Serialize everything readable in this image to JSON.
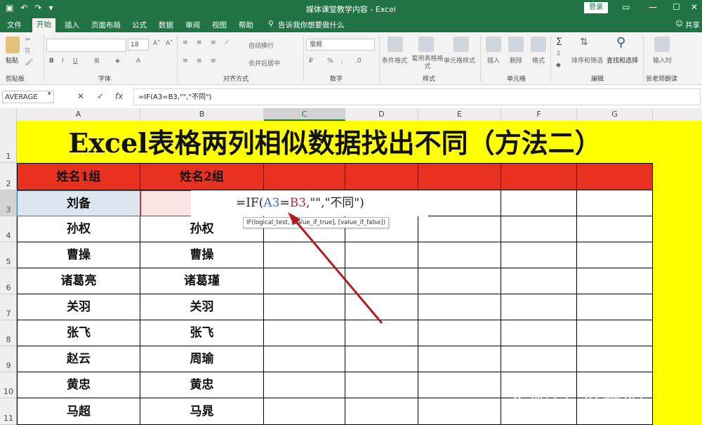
{
  "window": {
    "title": "媒体课堂教学内容 - Excel",
    "login_label": "登录",
    "share_label": "共享"
  },
  "tabs": [
    "文件",
    "开始",
    "插入",
    "页面布局",
    "公式",
    "数据",
    "审阅",
    "视图",
    "帮助"
  ],
  "tell_me": "告诉我你想要做什么",
  "ribbon": {
    "groups": [
      "剪贴板",
      "字体",
      "对齐方式",
      "数字",
      "样式",
      "单元格",
      "编辑",
      "张老师朗读"
    ],
    "paste_label": "粘贴",
    "font_size": "18",
    "wrap_text": "自动换行",
    "merge_center": "合并后居中",
    "number_format": "常规",
    "conditional_format": "条件格式",
    "format_as_table": "套用表格格式",
    "cell_styles": "单元格样式",
    "insert": "插入",
    "delete": "删除",
    "format": "格式",
    "sort_filter": "排序和筛选",
    "find_select": "查找和选择",
    "input_time": "输入时"
  },
  "formula_bar": {
    "name_box": "AVERAGE",
    "formula": "=IF(A3=B3,\"\",\"不同\")"
  },
  "columns": [
    "A",
    "B",
    "C",
    "D",
    "E",
    "F",
    "G"
  ],
  "rows": [
    "1",
    "2",
    "3",
    "4",
    "5",
    "6",
    "7",
    "8",
    "9",
    "10",
    "11"
  ],
  "sheet": {
    "title": "Excel表格两列相似数据找出不同（方法二）",
    "header_a": "姓名1组",
    "header_b": "姓名2组",
    "col_a": [
      "刘备",
      "孙权",
      "曹操",
      "诸葛亮",
      "关羽",
      "张飞",
      "赵云",
      "黄忠",
      "马超"
    ],
    "col_b": [
      "",
      "孙权",
      "曹操",
      "诸葛瑾",
      "关羽",
      "张飞",
      "周瑜",
      "黄忠",
      "马晁"
    ]
  },
  "editing_formula": {
    "prefix": "=IF(",
    "ref_a": "A3",
    "eq": "=",
    "ref_b": "B3",
    "rest": ",\"\",\"不同\")"
  },
  "tooltip": "IF(logical_test, [value_if_true], [value_if_false])",
  "watermark": "企鹅号 张彦阳",
  "colors": {
    "excel_green": "#217346",
    "title_fill": "#ffff00",
    "header_fill": "#e8321f",
    "arrow": "#b01d20"
  }
}
